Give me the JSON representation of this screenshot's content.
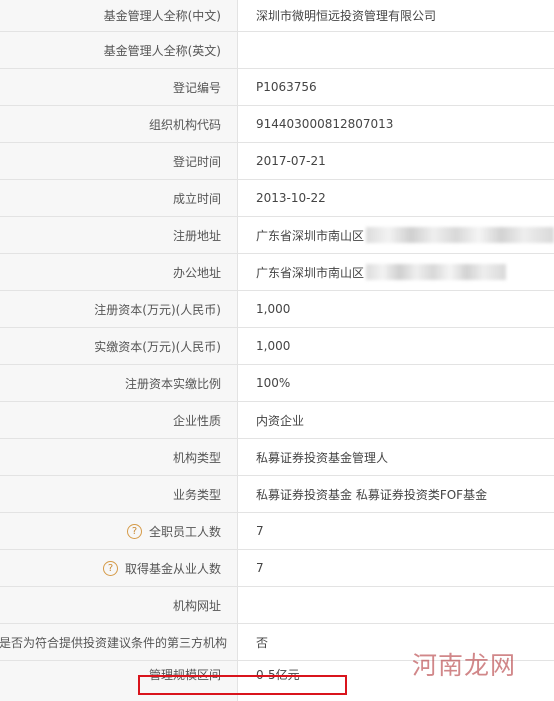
{
  "rows": [
    {
      "label": "基金管理人全称(中文)",
      "value": "深圳市微明恒远投资管理有限公司"
    },
    {
      "label": "基金管理人全称(英文)",
      "value": ""
    },
    {
      "label": "登记编号",
      "value": "P1063756"
    },
    {
      "label": "组织机构代码",
      "value": "914403000812807013"
    },
    {
      "label": "登记时间",
      "value": "2017-07-21"
    },
    {
      "label": "成立时间",
      "value": "2013-10-22"
    },
    {
      "label": "注册地址",
      "value": "广东省深圳市南山区"
    },
    {
      "label": "办公地址",
      "value": "广东省深圳市南山区"
    },
    {
      "label": "注册资本(万元)(人民币)",
      "value": "1,000"
    },
    {
      "label": "实缴资本(万元)(人民币)",
      "value": "1,000"
    },
    {
      "label": "注册资本实缴比例",
      "value": "100%"
    },
    {
      "label": "企业性质",
      "value": "内资企业"
    },
    {
      "label": "机构类型",
      "value": "私募证券投资基金管理人"
    },
    {
      "label": "业务类型",
      "value": "私募证券投资基金  私募证券投资类FOF基金"
    },
    {
      "label": "全职员工人数",
      "value": "7",
      "icon": "?"
    },
    {
      "label": "取得基金从业人数",
      "value": "7",
      "icon": "?"
    },
    {
      "label": "机构网址",
      "value": ""
    },
    {
      "label": "是否为符合提供投资建议条件的第三方机构",
      "value": "否"
    },
    {
      "label": "管理规模区间",
      "value": "0-5亿元"
    }
  ],
  "watermark": "河南龙网",
  "colors": {
    "highlight": "#d9141c",
    "label_bg": "#f7f7f7",
    "border": "#e3e3e3"
  }
}
